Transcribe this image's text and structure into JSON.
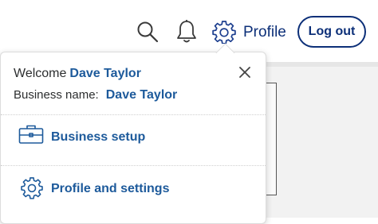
{
  "header": {
    "search_icon": "search-icon",
    "notifications_icon": "bell-icon",
    "settings_icon": "gear-icon",
    "profile_label": "Profile",
    "logout_label": "Log out"
  },
  "dropdown": {
    "welcome_prefix": "Welcome",
    "welcome_name": "Dave Taylor",
    "business_label": "Business name:",
    "business_name": "Dave Taylor",
    "close_icon": "close-icon",
    "items": [
      {
        "icon": "briefcase-icon",
        "label": "Business setup"
      },
      {
        "icon": "gear-icon",
        "label": "Profile and settings"
      }
    ]
  },
  "colors": {
    "brand_navy": "#0c2f78",
    "link_blue": "#1d5a9b",
    "text": "#2c2e2f"
  }
}
